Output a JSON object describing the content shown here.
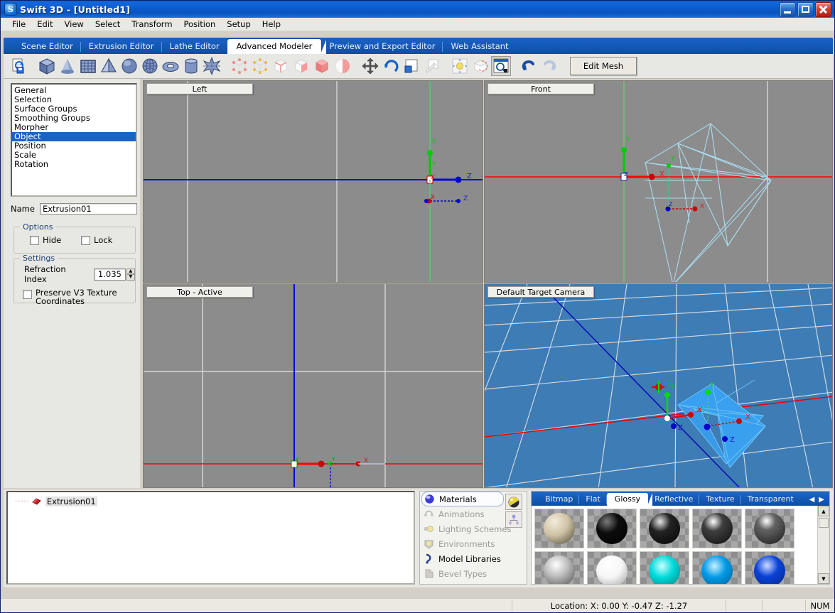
{
  "window": {
    "title": "Swift 3D - [Untitled1]",
    "app_glyph": "S",
    "minimize": "minimize-button",
    "maximize": "restore-button",
    "close": "close-button"
  },
  "menu": [
    "File",
    "Edit",
    "View",
    "Select",
    "Transform",
    "Position",
    "Setup",
    "Help"
  ],
  "editor_tabs": [
    {
      "label": "Scene Editor",
      "active": false
    },
    {
      "label": "Extrusion Editor",
      "active": false
    },
    {
      "label": "Lathe Editor",
      "active": false
    },
    {
      "label": "Advanced Modeler",
      "active": true
    },
    {
      "label": "Preview and Export Editor",
      "active": false
    },
    {
      "label": "Web Assistant",
      "active": false
    }
  ],
  "toolbar": {
    "edit_mesh_label": "Edit Mesh",
    "buttons": [
      {
        "name": "import-export-icon",
        "group": 0
      },
      {
        "name": "cube-primitive-icon",
        "group": 1
      },
      {
        "name": "cone-primitive-icon",
        "group": 1
      },
      {
        "name": "grid-plane-primitive-icon",
        "group": 1
      },
      {
        "name": "pyramid-primitive-icon",
        "group": 1
      },
      {
        "name": "sphere-primitive-icon",
        "group": 1
      },
      {
        "name": "geosphere-primitive-icon",
        "group": 1
      },
      {
        "name": "torus-primitive-icon",
        "group": 1
      },
      {
        "name": "cylinder-primitive-icon",
        "group": 1
      },
      {
        "name": "star-primitive-icon",
        "group": 1
      },
      {
        "name": "select-vertex-icon",
        "group": 2
      },
      {
        "name": "select-point-icon",
        "group": 2
      },
      {
        "name": "select-edge-icon",
        "group": 2
      },
      {
        "name": "select-face-icon",
        "group": 2
      },
      {
        "name": "select-solid-icon",
        "group": 2
      },
      {
        "name": "select-surface-icon",
        "group": 2
      },
      {
        "name": "move-tool-icon",
        "group": 3
      },
      {
        "name": "rotate-tool-icon",
        "group": 3
      },
      {
        "name": "scale-tool-icon",
        "group": 3
      },
      {
        "name": "sketch-tool-icon",
        "group": 3
      },
      {
        "name": "light-tool-icon",
        "group": 4
      },
      {
        "name": "bevel-tool-icon",
        "group": 4
      },
      {
        "name": "zoom-window-icon",
        "group": 4,
        "pressed": true
      },
      {
        "name": "undo-icon",
        "group": 5
      },
      {
        "name": "redo-icon",
        "group": 5
      }
    ]
  },
  "properties": {
    "list_items": [
      "General",
      "Selection",
      "Surface Groups",
      "Smoothing Groups",
      "Morpher",
      "Object",
      "Position",
      "Scale",
      "Rotation"
    ],
    "selected_item": "Object",
    "name_label": "Name",
    "name_value": "Extrusion01",
    "options_group": "Options",
    "hide_label": "Hide",
    "hide_checked": false,
    "lock_label": "Lock",
    "lock_checked": false,
    "settings_group": "Settings",
    "refraction_label": "Refraction Index",
    "refraction_value": "1.035",
    "preserve_label_line1": "Preserve V3 Texture",
    "preserve_label_line2": "Coordinates",
    "preserve_checked": false
  },
  "viewports": [
    {
      "id": "left",
      "label": "Left"
    },
    {
      "id": "front",
      "label": "Front"
    },
    {
      "id": "top",
      "label": "Top - Active"
    },
    {
      "id": "cam",
      "label": "Default Target Camera"
    }
  ],
  "scene_tree": {
    "items": [
      {
        "label": "Extrusion01",
        "icon": "mesh-object-icon",
        "selected": true
      }
    ]
  },
  "library": {
    "items": [
      {
        "label": "Materials",
        "icon": "sphere-icon",
        "enabled": true,
        "highlighted": true
      },
      {
        "label": "Animations",
        "icon": "animation-icon",
        "enabled": false,
        "highlighted": false
      },
      {
        "label": "Lighting Schemes",
        "icon": "light-icon",
        "enabled": false,
        "highlighted": false
      },
      {
        "label": "Environments",
        "icon": "environment-icon",
        "enabled": false,
        "highlighted": false
      },
      {
        "label": "Model Libraries",
        "icon": "model-library-icon",
        "enabled": true,
        "highlighted": false
      },
      {
        "label": "Bevel Types",
        "icon": "bevel-icon",
        "enabled": false,
        "highlighted": false
      }
    ],
    "tool_buttons": [
      {
        "name": "edit-material-icon"
      },
      {
        "name": "hierarchy-icon"
      }
    ]
  },
  "materials": {
    "tabs": [
      {
        "label": "Bitmap",
        "active": false
      },
      {
        "label": "Flat",
        "active": false
      },
      {
        "label": "Glossy",
        "active": true
      },
      {
        "label": "Reflective",
        "active": false
      },
      {
        "label": "Texture",
        "active": false
      },
      {
        "label": "Transparent",
        "active": false
      }
    ],
    "nav_prev": "◀",
    "nav_next": "▶",
    "swatches": [
      {
        "name": "beige-glossy",
        "color": "#cfc2a4",
        "hi": "#f3ecdd"
      },
      {
        "name": "black-glossy",
        "color": "#070707",
        "hi": "#7a7a7a"
      },
      {
        "name": "dark-gray-glossy",
        "color": "#1e1e1e",
        "hi": "#e8e8e8"
      },
      {
        "name": "gray-glossy",
        "color": "#3a3a3a",
        "hi": "#ffffff"
      },
      {
        "name": "medium-gray-glossy",
        "color": "#5c5c5c",
        "hi": "#ffffff"
      },
      {
        "name": "silver-glossy",
        "color": "#b6b6b6",
        "hi": "#ffffff"
      },
      {
        "name": "white-glossy",
        "color": "#f2f2f2",
        "hi": "#ffffff"
      },
      {
        "name": "cyan-glossy",
        "color": "#00d8d8",
        "hi": "#b8ffff"
      },
      {
        "name": "sky-blue-glossy",
        "color": "#0099e6",
        "hi": "#b6ecff"
      },
      {
        "name": "blue-glossy",
        "color": "#0a42d8",
        "hi": "#9fc0ff"
      }
    ],
    "scroll_up": "▲",
    "scroll_down": "▼"
  },
  "statusbar": {
    "location": "Location: X: 0.00   Y: -0.47   Z: -1.27",
    "num_indicator": "NUM"
  },
  "colors": {
    "titlebar_blue": "#0d5ed2",
    "tab_blue": "#1457b4",
    "selection_blue": "#1a62c6",
    "viewport_gray": "#8c8c8c",
    "camera_blue": "#3d7cb5",
    "axis_x_red": "#ff0000",
    "axis_y_green": "#00cc00",
    "axis_z_blue": "#0000dd",
    "wireframe_cyan": "#a8dcf0",
    "shape_blue": "#3399ff"
  }
}
